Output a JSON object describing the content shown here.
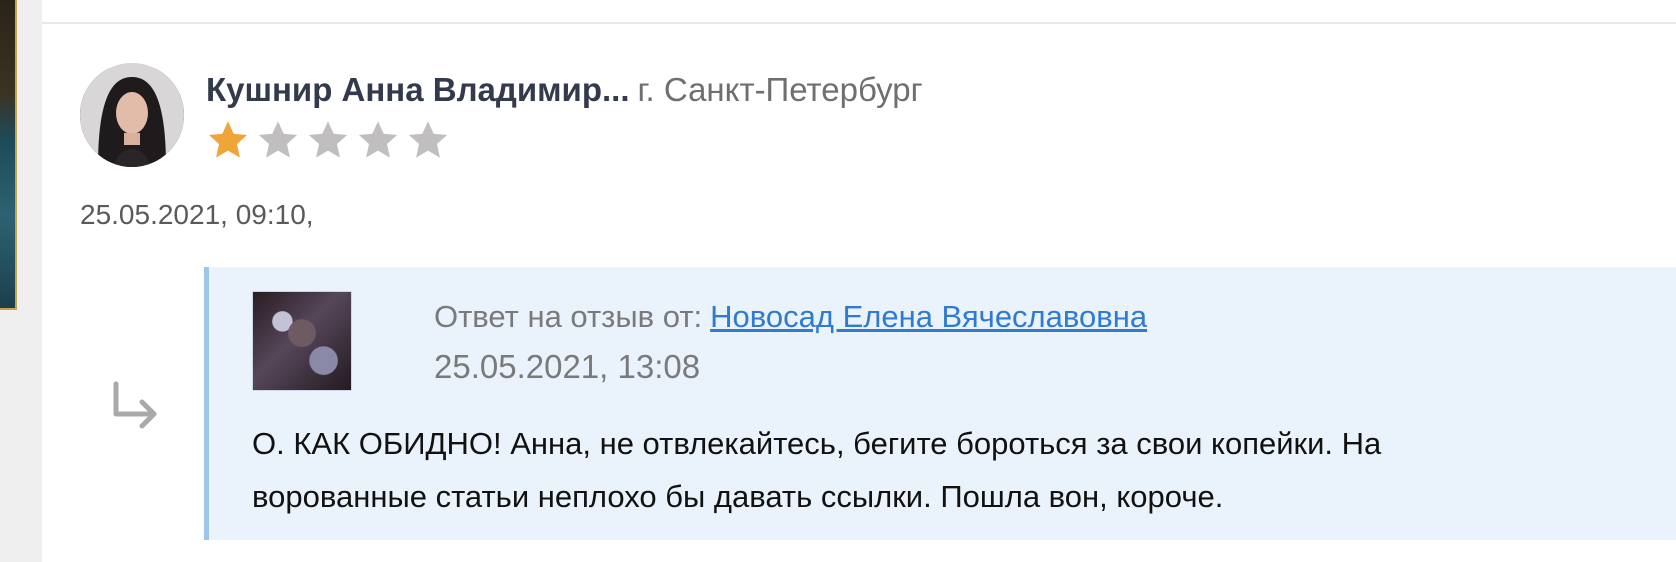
{
  "review": {
    "author_name": "Кушнир Анна Владимир...",
    "author_city": "г. Санкт-Петербург",
    "rating": 1,
    "rating_max": 5,
    "date": "25.05.2021, 09:10,"
  },
  "reply": {
    "label": "Ответ на отзыв от:",
    "author_link": "Новосад Елена Вячеславовна",
    "date": "25.05.2021, 13:08",
    "text_line1": "О. КАК ОБИДНО! Анна, не отвлекайтесь, бегите бороться за свои копейки. На",
    "text_line2": "ворованные статьи неплохо бы давать ссылки. Пошла вон, короче."
  },
  "icons": {
    "star": "star-icon",
    "reply": "reply-arrow-icon"
  },
  "colors": {
    "star_active": "#f0a53a",
    "star_inactive": "#c0bebe",
    "link": "#2f7bd1",
    "reply_bg": "#eaf3fc",
    "reply_border": "#9cc6ea"
  }
}
